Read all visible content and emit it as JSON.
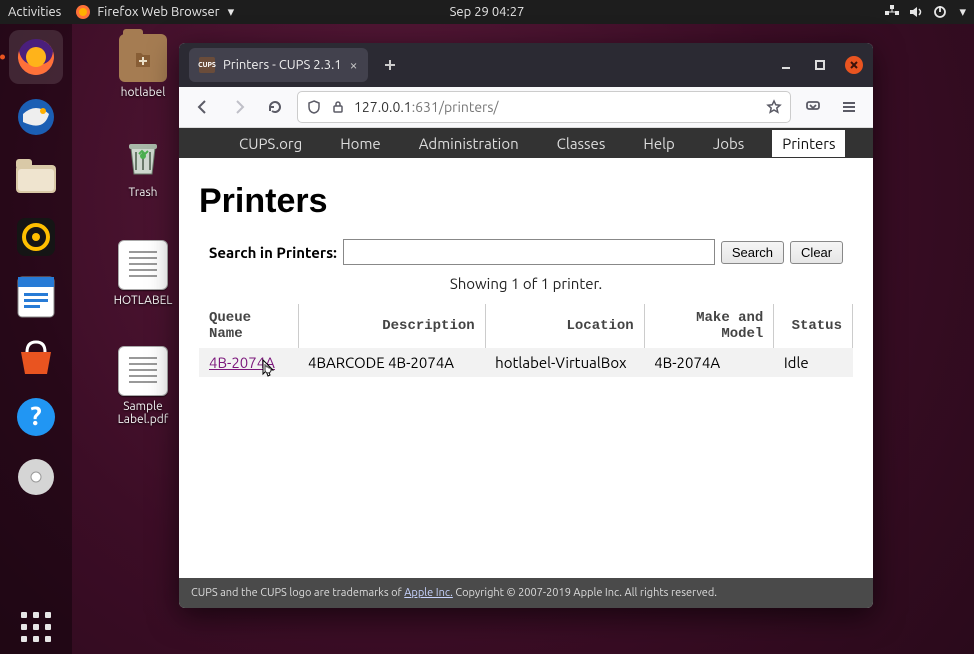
{
  "topbar": {
    "activities": "Activities",
    "app_name": "Firefox Web Browser",
    "datetime": "Sep 29  04:27"
  },
  "desktop_icons": {
    "folder1": "hotlabel",
    "trash": "Trash",
    "file1": "HOTLABEL",
    "file2": "Sample Label.pdf"
  },
  "browser": {
    "tab_title": "Printers - CUPS 2.3.1",
    "tab_favicon": "CUPS",
    "url_host": "127.0.0.1",
    "url_port": ":631",
    "url_path": "/printers/"
  },
  "cups_nav": {
    "org": "CUPS.org",
    "home": "Home",
    "admin": "Administration",
    "classes": "Classes",
    "help": "Help",
    "jobs": "Jobs",
    "printers": "Printers"
  },
  "page": {
    "title": "Printers",
    "search_label": "Search in Printers:",
    "search_btn": "Search",
    "clear_btn": "Clear",
    "showing": "Showing 1 of 1 printer.",
    "columns": {
      "queue": "Queue Name",
      "desc": "Description",
      "loc": "Location",
      "make": "Make and Model",
      "status": "Status"
    },
    "rows": [
      {
        "queue": "4B-2074A",
        "desc": "4BARCODE 4B-2074A",
        "loc": "hotlabel-VirtualBox",
        "make": "4B-2074A",
        "status": "Idle"
      }
    ]
  },
  "footer": {
    "pre": "CUPS and the CUPS logo are trademarks of ",
    "link": "Apple Inc.",
    "post": " Copyright © 2007-2019 Apple Inc. All rights reserved."
  }
}
